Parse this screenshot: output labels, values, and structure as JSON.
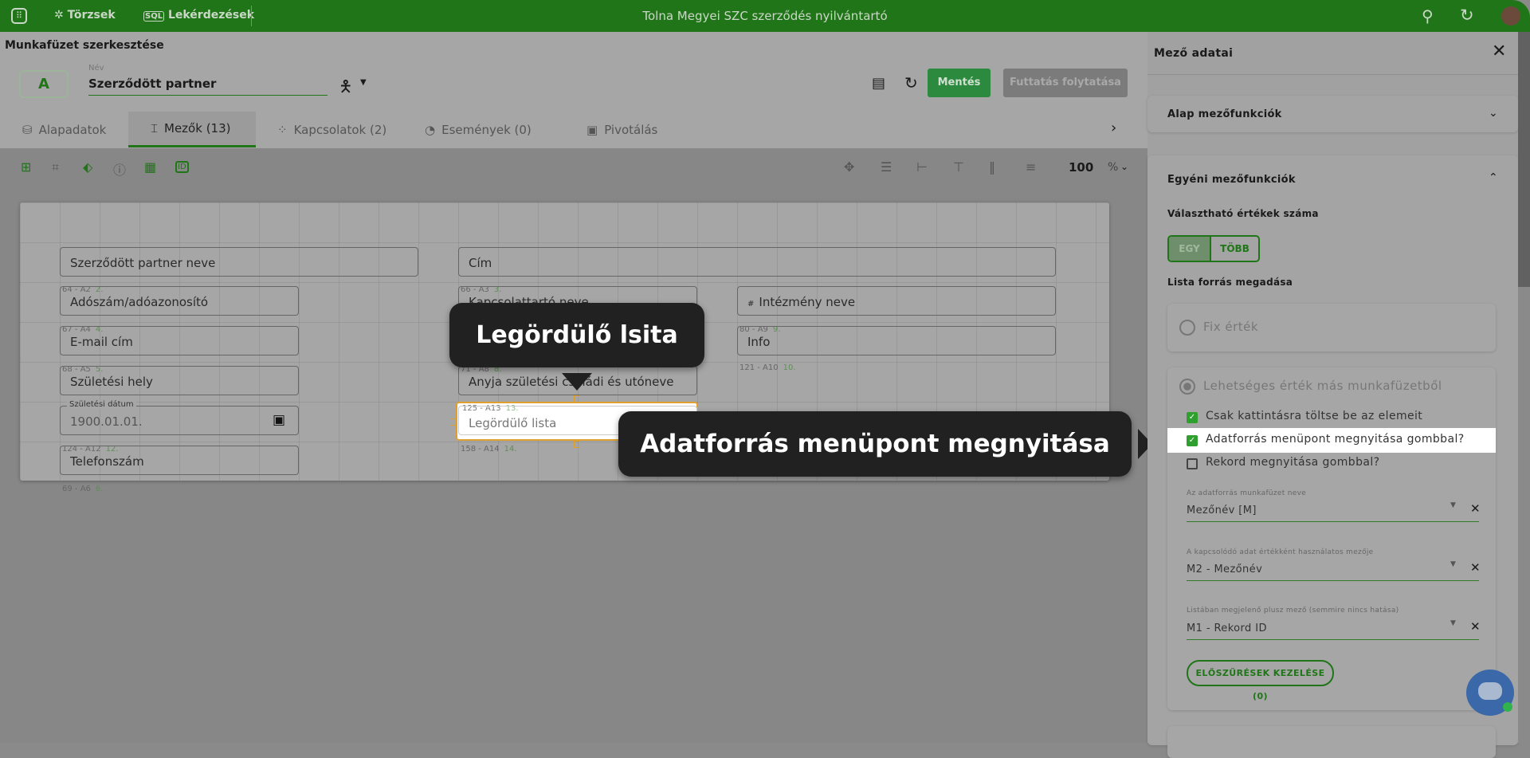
{
  "app": {
    "title": "Tolna Megyei SZC szerződés nyilvántartó",
    "nav": [
      {
        "label": "Törzsek",
        "icon": "hub-icon"
      },
      {
        "label": "Lekérdezések",
        "icon": "sql-icon"
      }
    ]
  },
  "colors": {
    "brand": "#217519",
    "tooltip": "#212121",
    "highlight": "#e0a030"
  },
  "header": {
    "page_title": "Munkafüzet szerkesztése",
    "avatar_letter": "A",
    "name_label": "Név",
    "name_value": "Szerződött partner",
    "save": "Mentés",
    "continue": "Futtatás folytatása"
  },
  "tabs": [
    {
      "label": "Alapadatok",
      "icon": "database-icon"
    },
    {
      "label": "Mezők (13)",
      "icon": "field-icon",
      "active": true
    },
    {
      "label": "Kapcsolatok (2)",
      "icon": "relations-icon"
    },
    {
      "label": "Események (0)",
      "icon": "timer-icon"
    },
    {
      "label": "Pivotálás",
      "icon": "pivot-icon"
    }
  ],
  "toolbar": {
    "zoom": "100",
    "zoom_unit": "%"
  },
  "fields": [
    {
      "label": "Szerződött partner neve"
    },
    {
      "label": "Cím"
    },
    {
      "meta": "64 - A2",
      "num": "2.",
      "label": "Adószám/adóazonosító"
    },
    {
      "meta": "66 - A3",
      "num": "3.",
      "label": "Kapcsolattartó neve"
    },
    {
      "label": "Intézmény neve",
      "prefix": "#"
    },
    {
      "meta": "67 - A4",
      "num": "4.",
      "label": "E-mail cím"
    },
    {
      "meta": "80 - A9",
      "num": "9.",
      "label": "Info"
    },
    {
      "meta": "121 - A10",
      "num": "10."
    },
    {
      "meta": "68 - A5",
      "num": "5.",
      "label": "Születési hely"
    },
    {
      "meta": "71 - A8",
      "num": "8.",
      "label": "Anyja születési családi és utóneve"
    },
    {
      "label": "Születési dátum",
      "value": "1900.01.01."
    },
    {
      "meta": "125 - A13",
      "num": "13.",
      "label": "Legördülő lista"
    },
    {
      "meta": "124 - A12",
      "num": "12.",
      "label": "Telefonszám"
    },
    {
      "meta": "158 - A14",
      "num": "14."
    },
    {
      "meta": "69 - A6",
      "num": "6."
    }
  ],
  "tooltips": {
    "dropdown": "Legördülő lsita",
    "datasource": "Adatforrás menüpont megnyitása"
  },
  "panel": {
    "title": "Mező adatai",
    "basic": "Alap mezőfunkciók",
    "custom": "Egyéni mezőfunkciók",
    "count_label": "Választható értékek száma",
    "count_options": [
      "EGY",
      "TÖBB"
    ],
    "count_selected": "EGY",
    "source_label": "Lista forrás megadása",
    "fixed": "Fix érték",
    "other": "Lehetséges érték más munkafüzetből",
    "checkboxes": [
      {
        "label": "Csak kattintásra töltse be az elemeit",
        "checked": true
      },
      {
        "label": "Adatforrás menüpont megnyitása gombbal?",
        "checked": true
      },
      {
        "label": "Rekord megnyitása gombbal?",
        "checked": false
      }
    ],
    "selects": [
      {
        "label": "Az adatforrás munkafüzet neve",
        "value": "Mezőnév [M]"
      },
      {
        "label": "A kapcsolódó adat értékként használatos mezője",
        "value": "M2 - Mezőnév"
      },
      {
        "label": "Listában megjelenő plusz mező (semmire nincs hatása)",
        "value": "M1 - Rekord ID"
      }
    ],
    "prefilter": "ELŐSZŰRÉSEK KEZELÉSE (0)"
  }
}
